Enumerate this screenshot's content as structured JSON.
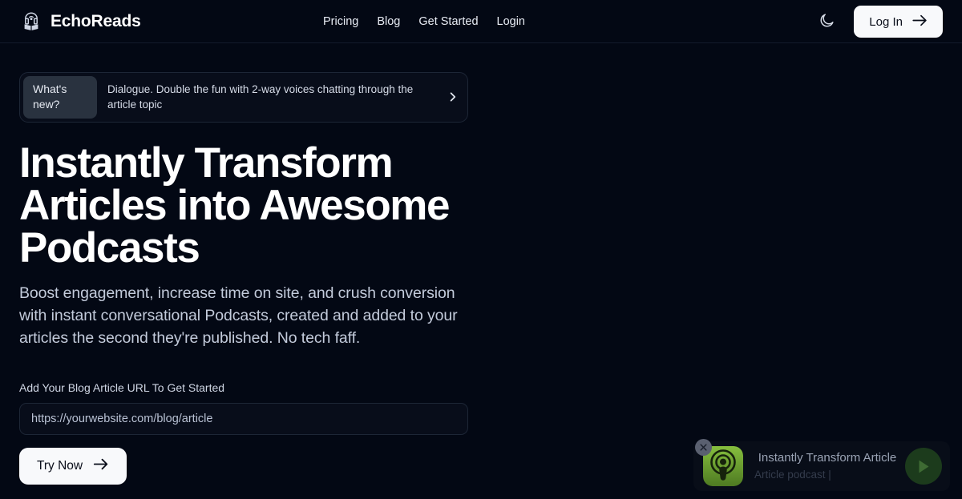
{
  "brand": {
    "name": "EchoReads",
    "logo_icon": "podcast-book-icon"
  },
  "nav": {
    "items": [
      {
        "label": "Pricing"
      },
      {
        "label": "Blog"
      },
      {
        "label": "Get Started"
      },
      {
        "label": "Login"
      }
    ]
  },
  "header_actions": {
    "theme_icon": "moon-icon",
    "login_label": "Log In",
    "login_arrow_icon": "arrow-right-icon"
  },
  "hero": {
    "banner": {
      "badge": "What's new?",
      "message": "Dialogue. Double the fun with 2-way voices chatting through the article topic",
      "chevron_icon": "chevron-right-icon"
    },
    "headline": "Instantly Transform Articles into Awesome Podcasts",
    "subhead": "Boost engagement, increase time on site, and crush conversion with instant conversational Podcasts, created and added to your articles the second they're published. No tech faff.",
    "form": {
      "label": "Add Your Blog Article URL To Get Started",
      "input_value": "",
      "input_placeholder": "https://yourwebsite.com/blog/article",
      "submit_label": "Try Now",
      "submit_arrow_icon": "arrow-right-icon"
    }
  },
  "player": {
    "close_icon": "close-icon",
    "artwork_icon": "apple-podcasts-icon",
    "title": "Instantly Transform Article",
    "subtitle": "Article podcast |",
    "play_icon": "play-icon"
  },
  "colors": {
    "background": "#030814",
    "surface": "#080d1a",
    "border": "#1d2636",
    "pill": "#29323f",
    "text_primary": "#ffffff",
    "text_secondary": "#c3cbdb",
    "button_bg": "#f8f9fb",
    "button_text": "#0a0e1a",
    "podcast_green": "#6aa62e",
    "play_bg": "#1c3b1c"
  }
}
